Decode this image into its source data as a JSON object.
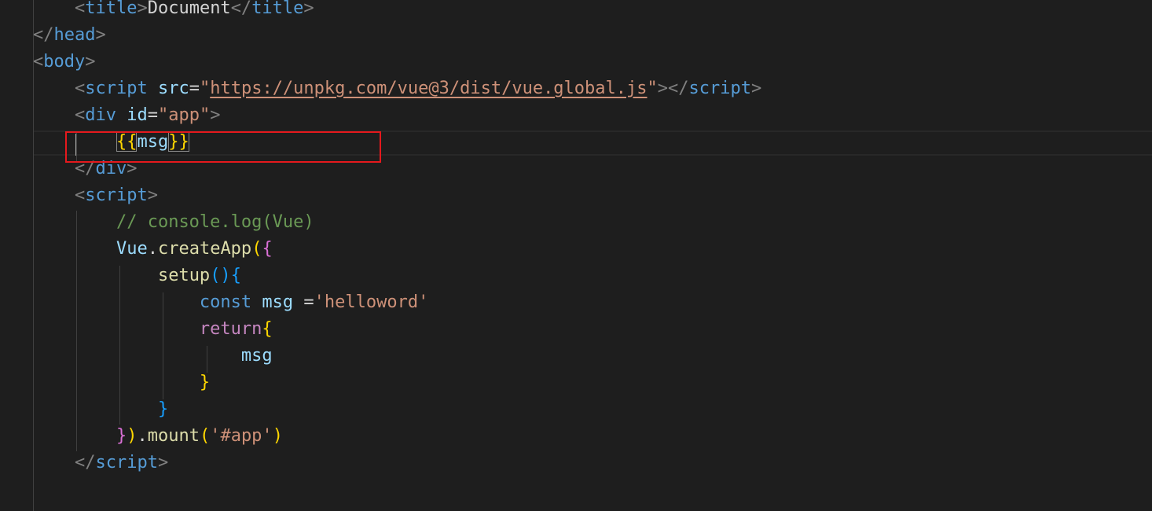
{
  "editor": {
    "lines": [
      {
        "indent": "    ",
        "tokens": [
          {
            "text": "<",
            "cls": "p"
          },
          {
            "text": "title",
            "cls": "t"
          },
          {
            "text": ">",
            "cls": "p"
          },
          {
            "text": "Document",
            "cls": "txt"
          },
          {
            "text": "</",
            "cls": "p"
          },
          {
            "text": "title",
            "cls": "t"
          },
          {
            "text": ">",
            "cls": "p"
          }
        ]
      },
      {
        "indent": "",
        "tokens": [
          {
            "text": "</",
            "cls": "p"
          },
          {
            "text": "head",
            "cls": "t"
          },
          {
            "text": ">",
            "cls": "p"
          }
        ]
      },
      {
        "indent": "",
        "tokens": [
          {
            "text": "<",
            "cls": "p"
          },
          {
            "text": "body",
            "cls": "t"
          },
          {
            "text": ">",
            "cls": "p"
          }
        ]
      },
      {
        "indent": "    ",
        "tokens": [
          {
            "text": "<",
            "cls": "p"
          },
          {
            "text": "script",
            "cls": "t"
          },
          {
            "text": " ",
            "cls": "txt"
          },
          {
            "text": "src",
            "cls": "a"
          },
          {
            "text": "=",
            "cls": "txt"
          },
          {
            "text": "\"",
            "cls": "s"
          },
          {
            "text": "https://unpkg.com/vue@3/dist/vue.global.js",
            "cls": "url"
          },
          {
            "text": "\"",
            "cls": "s"
          },
          {
            "text": "></",
            "cls": "p"
          },
          {
            "text": "script",
            "cls": "t"
          },
          {
            "text": ">",
            "cls": "p"
          }
        ]
      },
      {
        "indent": "    ",
        "tokens": [
          {
            "text": "<",
            "cls": "p"
          },
          {
            "text": "div",
            "cls": "t"
          },
          {
            "text": " ",
            "cls": "txt"
          },
          {
            "text": "id",
            "cls": "a"
          },
          {
            "text": "=",
            "cls": "txt"
          },
          {
            "text": "\"app\"",
            "cls": "s"
          },
          {
            "text": ">",
            "cls": "p"
          }
        ]
      },
      {
        "indent": "        ",
        "tokens": [
          {
            "text": "{{",
            "cls": "b1 match"
          },
          {
            "text": "msg",
            "cls": "v"
          },
          {
            "text": "}}",
            "cls": "b1 match"
          }
        ]
      },
      {
        "indent": "    ",
        "tokens": [
          {
            "text": "</",
            "cls": "p"
          },
          {
            "text": "div",
            "cls": "t"
          },
          {
            "text": ">",
            "cls": "p"
          }
        ]
      },
      {
        "indent": "    ",
        "tokens": [
          {
            "text": "<",
            "cls": "p"
          },
          {
            "text": "script",
            "cls": "t"
          },
          {
            "text": ">",
            "cls": "p"
          }
        ]
      },
      {
        "indent": "        ",
        "tokens": [
          {
            "text": "// console.log(Vue)",
            "cls": "c"
          }
        ]
      },
      {
        "indent": "        ",
        "tokens": [
          {
            "text": "Vue",
            "cls": "v"
          },
          {
            "text": ".",
            "cls": "txt"
          },
          {
            "text": "createApp",
            "cls": "f"
          },
          {
            "text": "(",
            "cls": "b1"
          },
          {
            "text": "{",
            "cls": "b2"
          }
        ]
      },
      {
        "indent": "            ",
        "tokens": [
          {
            "text": "setup",
            "cls": "f"
          },
          {
            "text": "()",
            "cls": "b3"
          },
          {
            "text": "{",
            "cls": "b3"
          }
        ]
      },
      {
        "indent": "                ",
        "tokens": [
          {
            "text": "const",
            "cls": "t"
          },
          {
            "text": " ",
            "cls": "txt"
          },
          {
            "text": "msg",
            "cls": "v"
          },
          {
            "text": " =",
            "cls": "txt"
          },
          {
            "text": "'helloword'",
            "cls": "s"
          }
        ]
      },
      {
        "indent": "                ",
        "tokens": [
          {
            "text": "return",
            "cls": "kw"
          },
          {
            "text": "{",
            "cls": "b1"
          }
        ]
      },
      {
        "indent": "                    ",
        "tokens": [
          {
            "text": "msg",
            "cls": "v"
          }
        ]
      },
      {
        "indent": "                ",
        "tokens": [
          {
            "text": "}",
            "cls": "b1"
          }
        ]
      },
      {
        "indent": "            ",
        "tokens": [
          {
            "text": "}",
            "cls": "b3"
          }
        ]
      },
      {
        "indent": "        ",
        "tokens": [
          {
            "text": "}",
            "cls": "b2"
          },
          {
            "text": ")",
            "cls": "b1"
          },
          {
            "text": ".",
            "cls": "txt"
          },
          {
            "text": "mount",
            "cls": "f"
          },
          {
            "text": "(",
            "cls": "b1"
          },
          {
            "text": "'#app'",
            "cls": "s"
          },
          {
            "text": ")",
            "cls": "b1"
          }
        ]
      },
      {
        "indent": "    ",
        "tokens": [
          {
            "text": "</",
            "cls": "p"
          },
          {
            "text": "script",
            "cls": "t"
          },
          {
            "text": ">",
            "cls": "p"
          }
        ]
      }
    ]
  }
}
